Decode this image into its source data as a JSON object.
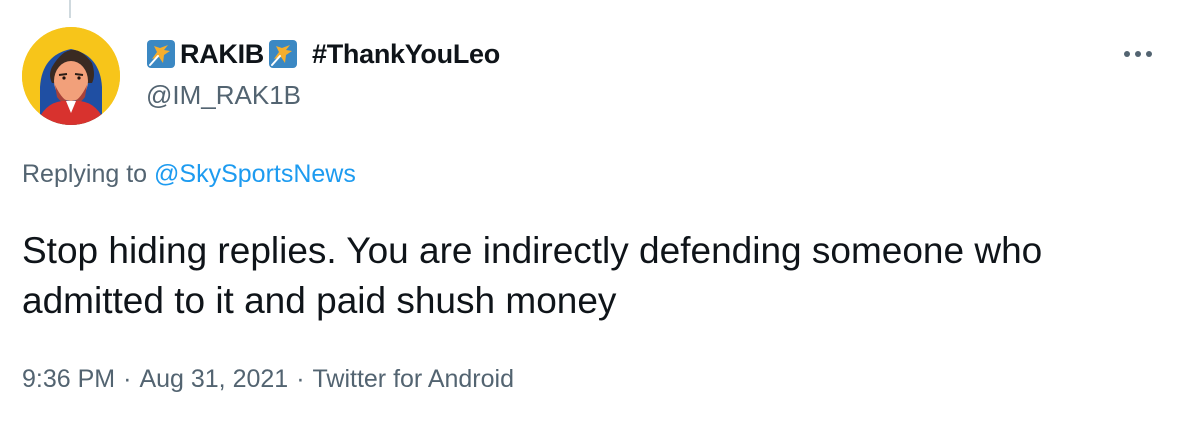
{
  "tweet": {
    "author": {
      "name": "RAKIB",
      "hashtag": "#ThankYouLeo",
      "handle": "@IM_RAK1B",
      "avatar_icon": "avatar-illustration",
      "badge_icon": "star-emoji-icon"
    },
    "more_icon": "more-options-icon",
    "replying_prefix": "Replying to",
    "replying_to": "@SkySportsNews",
    "text": "Stop hiding replies. You are indirectly defending someone who admitted to it and paid shush money",
    "time": "9:36 PM",
    "separator": "·",
    "date": "Aug 31, 2021",
    "source": "Twitter for Android"
  },
  "colors": {
    "text_primary": "#0f1419",
    "text_secondary": "#536471",
    "link": "#1d9bf0",
    "thread_line": "#cfd9de",
    "badge_bg": "#3b88c3",
    "badge_star": "#f6ae2d"
  }
}
